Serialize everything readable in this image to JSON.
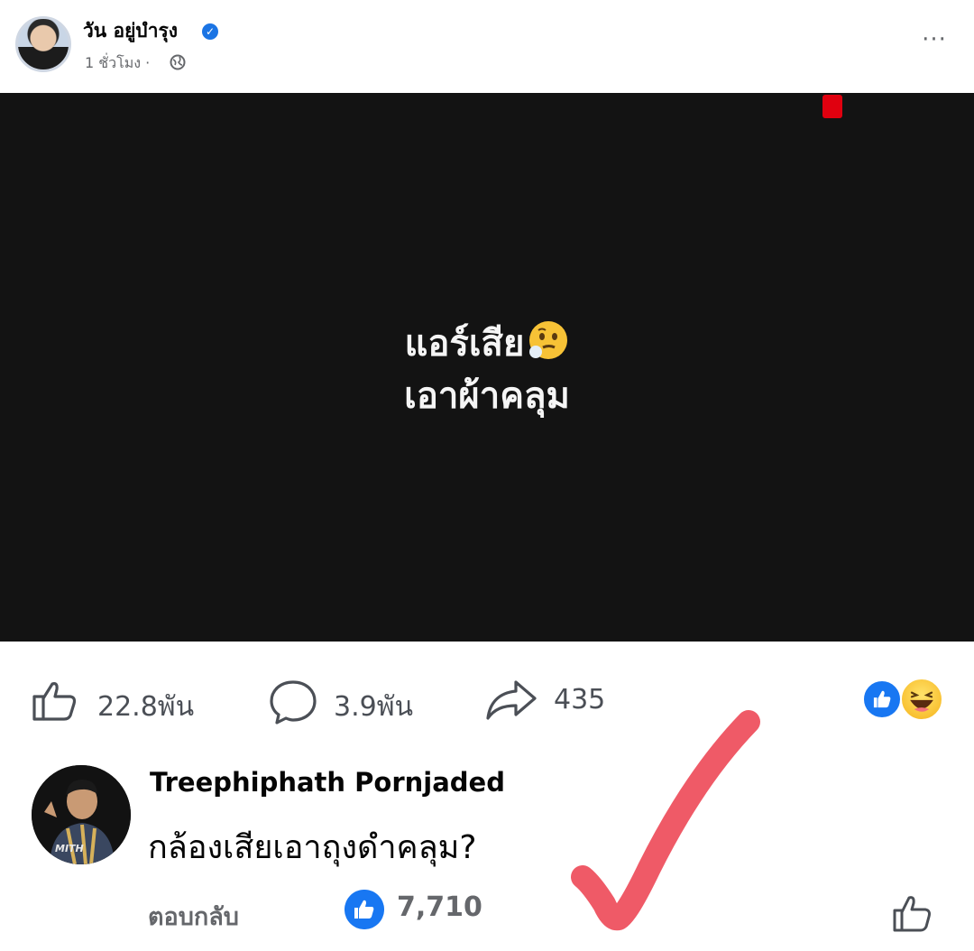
{
  "post": {
    "author_name": "วัน อยู่บำรุง",
    "time": "1 ชั่วโมง ·",
    "more_label": "···"
  },
  "video": {
    "caption_line1": "แอร์เสีย",
    "caption_line2": "เอาผ้าคลุม"
  },
  "stats": {
    "likes": "22.8พัน",
    "comments": "3.9พัน",
    "shares": "435"
  },
  "comment": {
    "author": "Treephiphath Pornjaded",
    "text": "กล้องเสียเอาถุงดำคลุม?",
    "reply_label": "ตอบกลับ",
    "like_count": "7,710",
    "avatar_shirt_text": "MITH"
  },
  "icons": {
    "verified": "verified-badge-icon",
    "privacy": "globe-icon",
    "like": "thumbs-up-icon",
    "comment": "comment-bubble-icon",
    "share": "share-arrow-icon",
    "reaction_like": "like-reaction-icon",
    "reaction_haha": "haha-reaction-icon",
    "thinking": "thinking-face-emoji"
  },
  "colors": {
    "facebook_blue": "#1877f2",
    "live_red": "#e0000f",
    "annotation_red": "#ef5a67",
    "video_bg": "#131313"
  }
}
